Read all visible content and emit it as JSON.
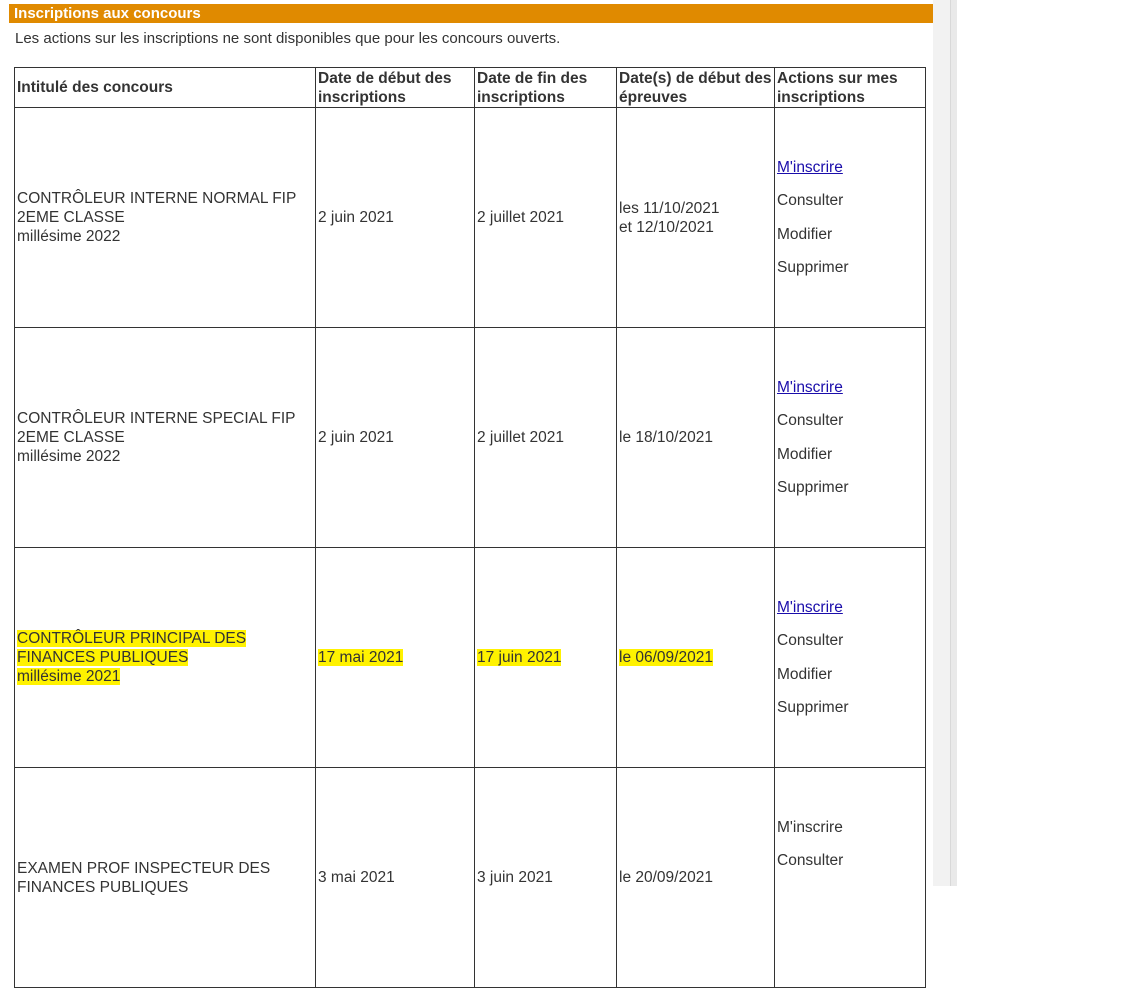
{
  "section": {
    "title": "Inscriptions aux concours",
    "notice": "Les actions sur les inscriptions ne sont disponibles que pour les concours ouverts."
  },
  "table": {
    "headers": [
      "Intitulé des concours",
      "Date de début des inscriptions",
      "Date de fin des inscriptions",
      "Date(s) de début des épreuves",
      "Actions sur mes inscriptions"
    ],
    "rows": [
      {
        "title_line1": "CONTRÔLEUR INTERNE NORMAL FIP",
        "title_line2": "2EME CLASSE",
        "title_line3": "millésime 2022",
        "start": "2 juin 2021",
        "end": "2 juillet 2021",
        "exam_line1": "les 11/10/2021",
        "exam_line2": "et 12/10/2021",
        "actions": [
          "M'inscrire",
          "Consulter",
          "Modifier",
          "Supprimer"
        ],
        "highlighted": false
      },
      {
        "title_line1": "CONTRÔLEUR INTERNE SPECIAL FIP",
        "title_line2": "2EME CLASSE",
        "title_line3": "millésime 2022",
        "start": "2 juin 2021",
        "end": "2 juillet 2021",
        "exam_line1": "le 18/10/2021",
        "exam_line2": "",
        "actions": [
          "M'inscrire",
          "Consulter",
          "Modifier",
          "Supprimer"
        ],
        "highlighted": false
      },
      {
        "title_line1": "CONTRÔLEUR PRINCIPAL DES",
        "title_line2": "FINANCES PUBLIQUES",
        "title_line3": "millésime 2021",
        "start": "17 mai 2021",
        "end": "17 juin 2021",
        "exam_line1": "le 06/09/2021",
        "exam_line2": "",
        "actions": [
          "M'inscrire",
          "Consulter",
          "Modifier",
          "Supprimer"
        ],
        "highlighted": true
      },
      {
        "title_line1": "EXAMEN PROF INSPECTEUR DES",
        "title_line2": "FINANCES PUBLIQUES",
        "title_line3": "",
        "start": "3 mai 2021",
        "end": "3 juin 2021",
        "exam_line1": "le 20/09/2021",
        "exam_line2": "",
        "actions": [
          "M'inscrire",
          "Consulter"
        ],
        "highlighted": false
      }
    ]
  },
  "colors": {
    "header_bar": "#e08a00",
    "link": "#1a0dab",
    "highlight": "#fff200",
    "text": "#333333"
  }
}
